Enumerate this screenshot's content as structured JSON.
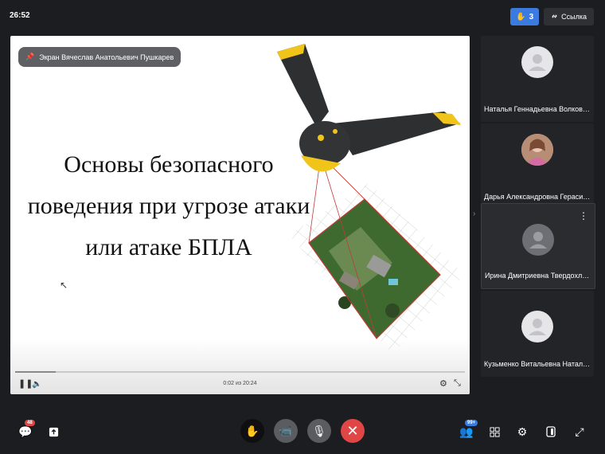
{
  "header": {
    "time": "26:52",
    "raised_hands_count": "3",
    "link_label": "Ссылка"
  },
  "stage": {
    "presenter_badge": "Экран Вячеслав Анатольевич Пушкарев",
    "slide_title_lines": [
      "Основы безопасного",
      "поведения при угрозе атаки",
      "или атаке БПЛА"
    ],
    "player": {
      "time_readout": "0:02 из 20:24",
      "progress_fraction": 0.09
    }
  },
  "participants": [
    {
      "name": "Наталья Геннадьевна Волкова",
      "avatar": "default",
      "muted": true
    },
    {
      "name": "Дарья Александровна Гераси...",
      "avatar": "photo",
      "muted": true
    },
    {
      "name": "Ирина Дмитриевна Твердохлеб",
      "avatar": "default",
      "muted": true,
      "active": true
    },
    {
      "name": "Кузьменко Витальевна Наталия",
      "avatar": "default",
      "muted": true
    }
  ],
  "bottom_bar": {
    "chat_badge": "48",
    "participants_badge": "99+"
  },
  "colors": {
    "accent": "#3b7be0",
    "hangup": "#e14646",
    "background": "#1c1d20"
  },
  "icons": [
    "hand-icon",
    "link-icon",
    "pin-icon",
    "pause-icon",
    "volume-icon",
    "settings-icon",
    "collapse-icon",
    "chat-icon",
    "share-icon",
    "raise-hand-icon",
    "camera-off-icon",
    "mic-off-icon",
    "hangup-icon",
    "participants-icon",
    "grid-icon",
    "gear-icon",
    "layout-icon",
    "fullscreen-icon"
  ]
}
